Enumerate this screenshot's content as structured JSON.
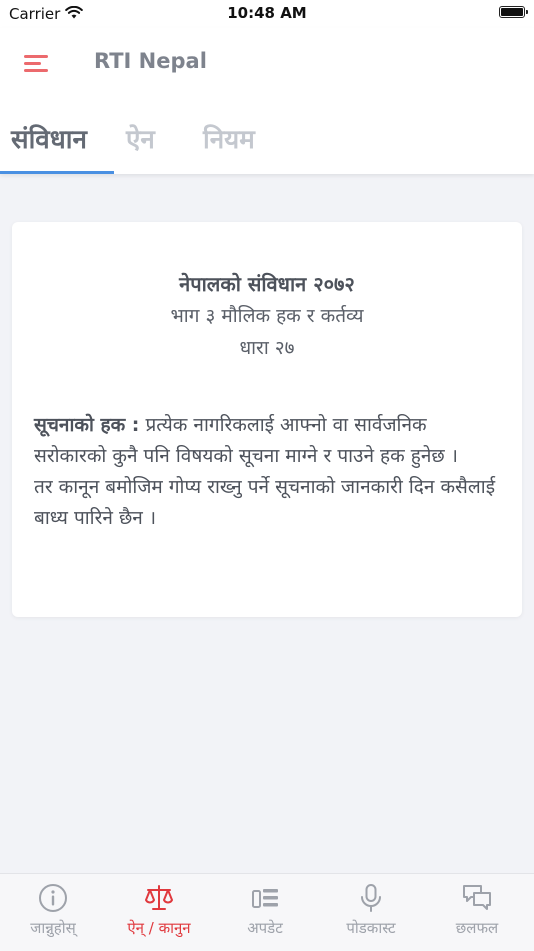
{
  "status_bar": {
    "carrier": "Carrier",
    "time": "10:48 AM"
  },
  "header": {
    "title": "RTI Nepal"
  },
  "tabs": [
    {
      "label": "संविधान",
      "active": true
    },
    {
      "label": "ऐन",
      "active": false
    },
    {
      "label": "नियम",
      "active": false
    }
  ],
  "card": {
    "heading": "नेपालको संविधान २०७२",
    "part": "भाग ३ मौलिक हक र कर्तव्य",
    "article": "धारा २७",
    "term": "सूचनाको हक :",
    "body_1": " प्रत्येक नागरिकलाई आफ्नो वा सार्वजनिक सरोकारको कुनै पनि विषयको सूचना माग्ने र पाउने हक हुनेछ ।",
    "body_2": "तर कानून बमोजिम गोप्य राख्नु पर्ने सूचनाको जानकारी दिन कसैलाई बाध्य पारिने छैन ।"
  },
  "tab_bar": {
    "items": [
      {
        "label": "जान्नुहोस्",
        "icon": "info-icon"
      },
      {
        "label": "ऐन् / कानुन",
        "icon": "scales-icon",
        "active": true
      },
      {
        "label": "अपडेट",
        "icon": "news-icon"
      },
      {
        "label": "पोडकास्ट",
        "icon": "microphone-icon"
      },
      {
        "label": "छलफल",
        "icon": "chat-icon"
      }
    ]
  },
  "colors": {
    "accent": "#ec6a6d",
    "active_tab_icon": "#e0393e",
    "tab_indicator": "#4a90e2",
    "inactive": "#9ea2aa"
  }
}
